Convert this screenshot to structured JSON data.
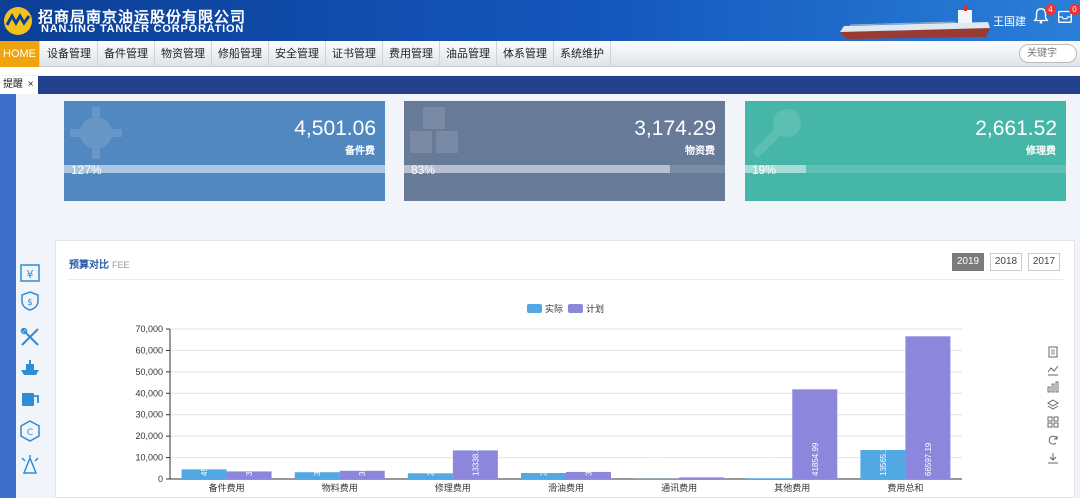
{
  "header": {
    "company_cn": "招商局南京油运股份有限公司",
    "company_en": "NANJING TANKER CORPORATION",
    "username": "王国建",
    "notifications_count": "4",
    "messages_count": "0"
  },
  "nav": {
    "items": [
      "HOME",
      "设备管理",
      "备件管理",
      "物资管理",
      "修船管理",
      "安全管理",
      "证书管理",
      "费用管理",
      "油品管理",
      "体系管理",
      "系统维护"
    ],
    "search_placeholder": "关键字"
  },
  "tabs": {
    "active_label": "提醒",
    "close_symbol": "×"
  },
  "cards": [
    {
      "value": "4,501.06",
      "label": "备件费",
      "percent": "127%",
      "progress": 1.0,
      "color": "#5288c0",
      "icon": "gear-icon"
    },
    {
      "value": "3,174.29",
      "label": "物资费",
      "percent": "83%",
      "progress": 0.83,
      "color": "#677a97",
      "icon": "boxes-icon"
    },
    {
      "value": "2,661.52",
      "label": "修理费",
      "percent": "19%",
      "progress": 0.19,
      "color": "#45b6a8",
      "icon": "wrench-icon"
    }
  ],
  "panel": {
    "title": "预算对比",
    "subtitle": "FEE",
    "years": [
      "2019",
      "2018",
      "2017"
    ],
    "active_year": "2019"
  },
  "chart_data": {
    "type": "bar",
    "categories": [
      "备件费用",
      "物料费用",
      "修理费用",
      "滑油费用",
      "通讯费用",
      "其他费用",
      "费用总和"
    ],
    "series": [
      {
        "name": "实际",
        "color": "#52a8e2",
        "values": [
          4501.06,
          3174.29,
          2661.52,
          2800.5,
          80.0,
          347.0,
          13565.1
        ],
        "labels": [
          "4501.06",
          "3174.29",
          "2661.52",
          "2800.50",
          "80.00",
          "347.00",
          "13565.1"
        ]
      },
      {
        "name": "计划",
        "color": "#8c87dc",
        "values": [
          3541.0,
          3825.0,
          13338.31,
          3303.0,
          758.0,
          41854.99,
          66597.19
        ],
        "labels": [
          "3541.0",
          "3825.00",
          "13338.31",
          "3303",
          "758",
          "41854.99",
          "66597.19"
        ]
      }
    ],
    "ylim": [
      0,
      70000
    ],
    "yticks": [
      "0",
      "10,000",
      "20,000",
      "30,000",
      "40,000",
      "50,000",
      "60,000",
      "70,000"
    ],
    "legend": "top-center",
    "grid": true
  }
}
